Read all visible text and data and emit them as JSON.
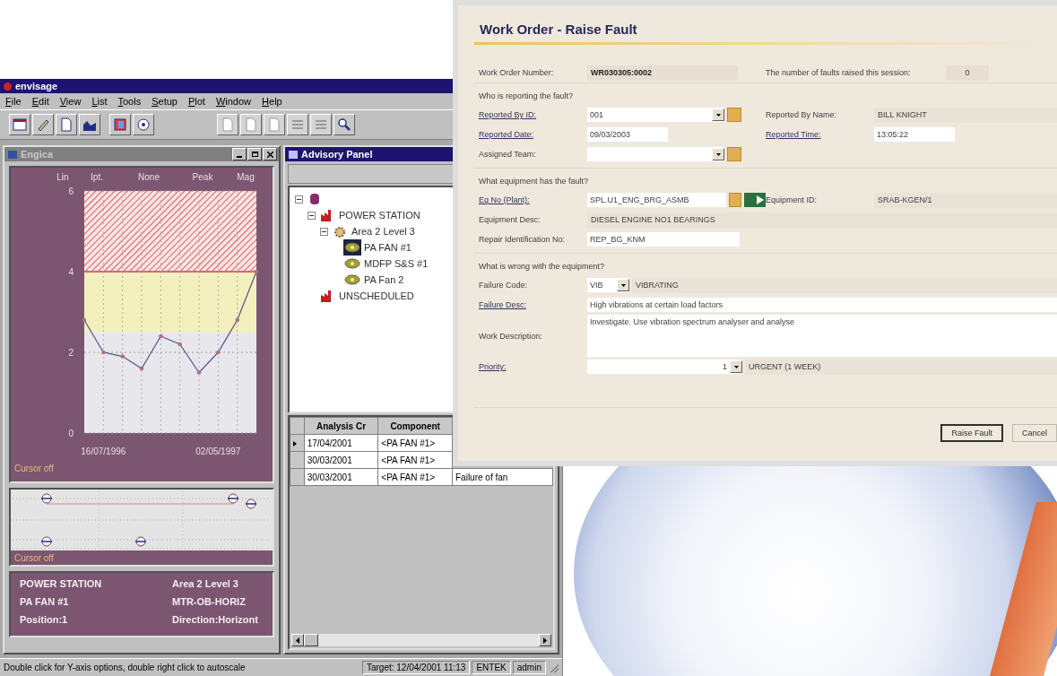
{
  "app": {
    "title": "envisage",
    "menu": [
      "File",
      "Edit",
      "View",
      "List",
      "Tools",
      "Setup",
      "Plot",
      "Window",
      "Help"
    ],
    "toolbar": [
      [
        {
          "disabled": false
        },
        {
          "disabled": false
        },
        {
          "disabled": false
        },
        {
          "disabled": false
        }
      ],
      [
        {
          "disabled": false
        },
        {
          "disabled": false
        }
      ],
      [
        {
          "disabled": true
        },
        {
          "disabled": true
        },
        {
          "disabled": true
        },
        {
          "disabled": true
        },
        {
          "disabled": true
        },
        {
          "disabled": false
        }
      ]
    ],
    "engica": {
      "title": "Engica",
      "chart_header": [
        "Lin",
        "Ipt.",
        "None",
        "Peak",
        "Mag"
      ],
      "chart_data": {
        "type": "line",
        "categories": [
          null,
          "16/07/1996",
          null,
          null,
          null,
          null,
          null,
          "02/05/1997",
          null,
          null
        ],
        "series": [
          {
            "color": "#5a5a8c",
            "values": [
              2.8,
              2.0,
              1.9,
              1.6,
              2.4,
              2.2,
              1.5,
              2.0,
              2.8,
              4.0
            ]
          }
        ],
        "ylim": [
          0,
          6
        ],
        "yticks": [
          0,
          2,
          4,
          6
        ],
        "grid": true
      },
      "cursor_label": "Cursor off",
      "trend_cursor_label": "Cursor off",
      "info": [
        [
          "POWER STATION",
          "Area 2 Level 3"
        ],
        [
          "PA FAN #1",
          "MTR-OB-HORIZ"
        ],
        [
          "Position:1",
          "Direction:Horizont"
        ]
      ]
    },
    "advisory_panel": {
      "title": "Advisory Panel",
      "tree": [
        {
          "kind": "database",
          "expanded": true,
          "selected": false,
          "children": [
            {
              "kind": "site",
              "label": "POWER STATION",
              "expanded": true,
              "selected": false,
              "children": [
                {
                  "kind": "area",
                  "label": "Area 2 Level 3",
                  "expanded": true,
                  "selected": false,
                  "children": [
                    {
                      "kind": "asset",
                      "label": "PA FAN #1",
                      "selected": true
                    },
                    {
                      "kind": "asset",
                      "label": "MDFP S&S #1",
                      "selected": false
                    },
                    {
                      "kind": "asset",
                      "label": "PA Fan 2",
                      "selected": false
                    }
                  ]
                }
              ]
            },
            {
              "kind": "site",
              "label": "UNSCHEDULED",
              "selected": false
            }
          ]
        }
      ],
      "grid": {
        "columns": [
          "Analysis Cr",
          "Component"
        ],
        "rows": [
          {
            "selected": true,
            "cells": [
              "17/04/2001",
              "<PA FAN #1>"
            ]
          },
          {
            "selected": false,
            "cells": [
              "30/03/2001",
              "<PA FAN #1>"
            ]
          },
          {
            "selected": false,
            "cells": [
              "30/03/2001",
              "<PA FAN #1>",
              "Failure of fan"
            ]
          }
        ]
      }
    },
    "status_bar": {
      "message": "Double click for Y-axis options, double right click to autoscale",
      "panes": [
        "Target: 12/04/2001 11:13",
        "ENTEK",
        "admin"
      ]
    }
  },
  "work_order": {
    "title": "Work Order - Raise Fault",
    "header_row": [
      {
        "label": "Work Order Number:",
        "link": false,
        "kind": "id",
        "value": "WR030305:0002"
      },
      {
        "label": "The number of faults raised this session:",
        "link": false,
        "kind": "count",
        "value": "0"
      }
    ],
    "sections": [
      {
        "heading": "Who is reporting the fault?",
        "rows": [
          [
            {
              "label": "Reported By ID:",
              "link": true,
              "kind": "lookup",
              "value": "001"
            },
            {
              "label": "Reported By Name:",
              "link": false,
              "kind": "text",
              "value": "BILL KNIGHT"
            }
          ],
          [
            {
              "label": "Reported Date:",
              "link": true,
              "kind": "short-input",
              "value": "09/03/2003"
            },
            {
              "label": "Reported Time:",
              "link": true,
              "kind": "short-input",
              "value": "13:05:22"
            }
          ],
          [
            {
              "label": "Assigned Team:",
              "link": false,
              "kind": "lookup"
            }
          ]
        ]
      },
      {
        "heading": "What equipment has the fault?",
        "rows": [
          [
            {
              "label": "Eq No (Plant):",
              "link": true,
              "kind": "lookup-jump",
              "value": "SPL.U1_ENG_BRG_ASMB"
            },
            {
              "label": "Equipment ID:",
              "link": false,
              "kind": "text",
              "value": "SRAB-KGEN/1"
            }
          ],
          [
            {
              "label": "Equipment Desc:",
              "link": false,
              "kind": "text",
              "value": "DIESEL ENGINE NO1 BEARINGS"
            }
          ],
          [
            {
              "label": "Repair Identification No:",
              "link": false,
              "kind": "input",
              "value": "REP_BG_KNM"
            }
          ]
        ]
      },
      {
        "heading": "What is wrong with the equipment?",
        "rows": [
          [
            {
              "label": "Failure Code:",
              "link": false,
              "kind": "combo-short",
              "value": "VIB",
              "note": "VIBRATING"
            }
          ],
          [
            {
              "label": "Failure Desc:",
              "link": true,
              "kind": "wide-input",
              "value": "High vibrations at certain load factors"
            }
          ],
          [
            {
              "label": "Work Description:",
              "link": false,
              "kind": "textarea",
              "value": "Investigate. Use vibration spectrum analyser and analyse"
            }
          ],
          [
            {
              "label": "Priority:",
              "link": true,
              "kind": "combo-num",
              "value": "1",
              "note": "URGENT (1 WEEK)"
            }
          ]
        ]
      }
    ],
    "buttons": [
      {
        "label": "Raise Fault",
        "default": true
      },
      {
        "label": "Cancel",
        "default": false
      }
    ]
  }
}
